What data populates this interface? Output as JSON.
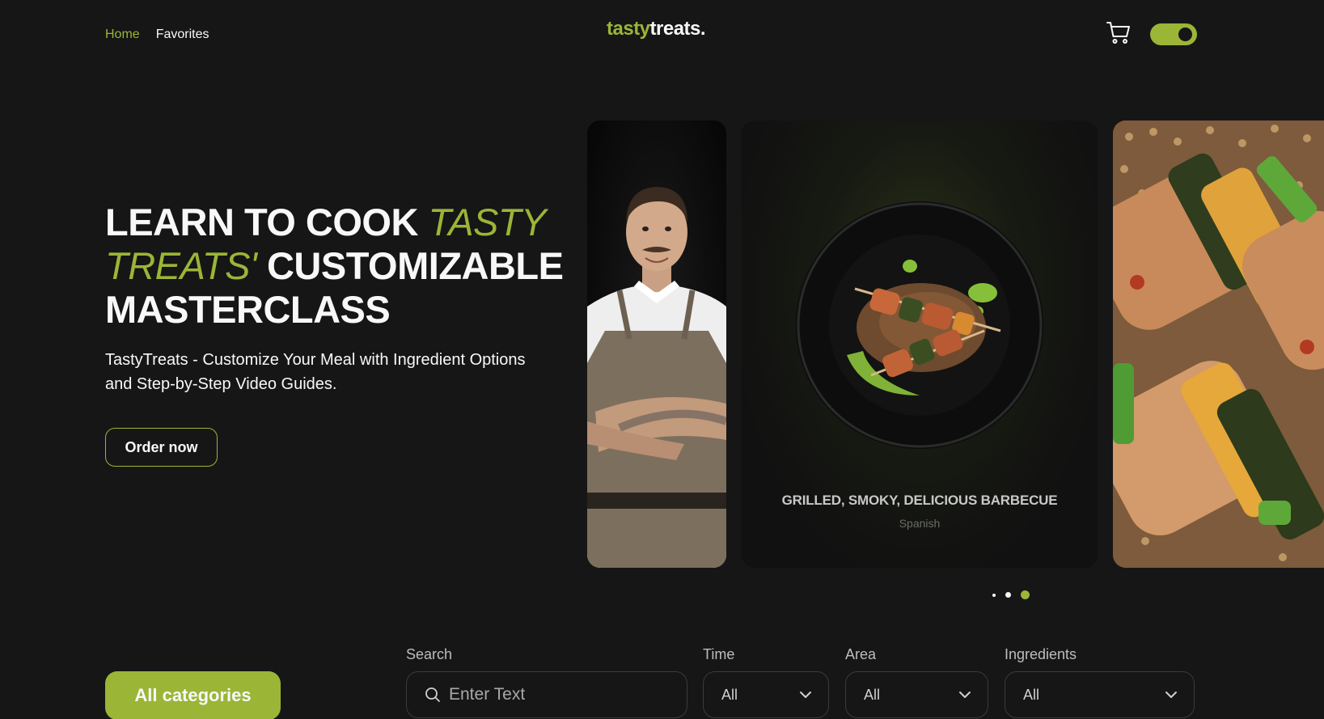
{
  "header": {
    "nav": [
      {
        "label": "Home",
        "active": true
      },
      {
        "label": "Favorites",
        "active": false
      }
    ],
    "logo_accent": "tasty",
    "logo_rest": "treats.",
    "cart_icon": "cart-icon",
    "theme_toggle": "on"
  },
  "hero": {
    "title_part1": "Learn to cook",
    "title_italic": "Tasty Treats'",
    "title_part2": "customizable Masterclass",
    "subtitle": "TastyTreats - Customize Your Meal with Ingredient Options and Step-by-Step Video Guides.",
    "cta_label": "Order now"
  },
  "slider": {
    "cards": [
      {
        "kind": "chef-photo"
      },
      {
        "kind": "dish",
        "title": "GRILLED, SMOKY, DELICIOUS BARBECUE",
        "area": "Spanish"
      },
      {
        "kind": "food-closeup"
      }
    ],
    "dots": 3,
    "active_dot": 3
  },
  "filters": {
    "all_categories_label": "All categories",
    "search_label": "Search",
    "search_placeholder": "Enter Text",
    "time_label": "Time",
    "time_value": "All",
    "area_label": "Area",
    "area_value": "All",
    "ingredients_label": "Ingredients",
    "ingredients_value": "All"
  },
  "colors": {
    "accent": "#9bb537",
    "background": "#161616",
    "text": "#f8f8f8"
  }
}
